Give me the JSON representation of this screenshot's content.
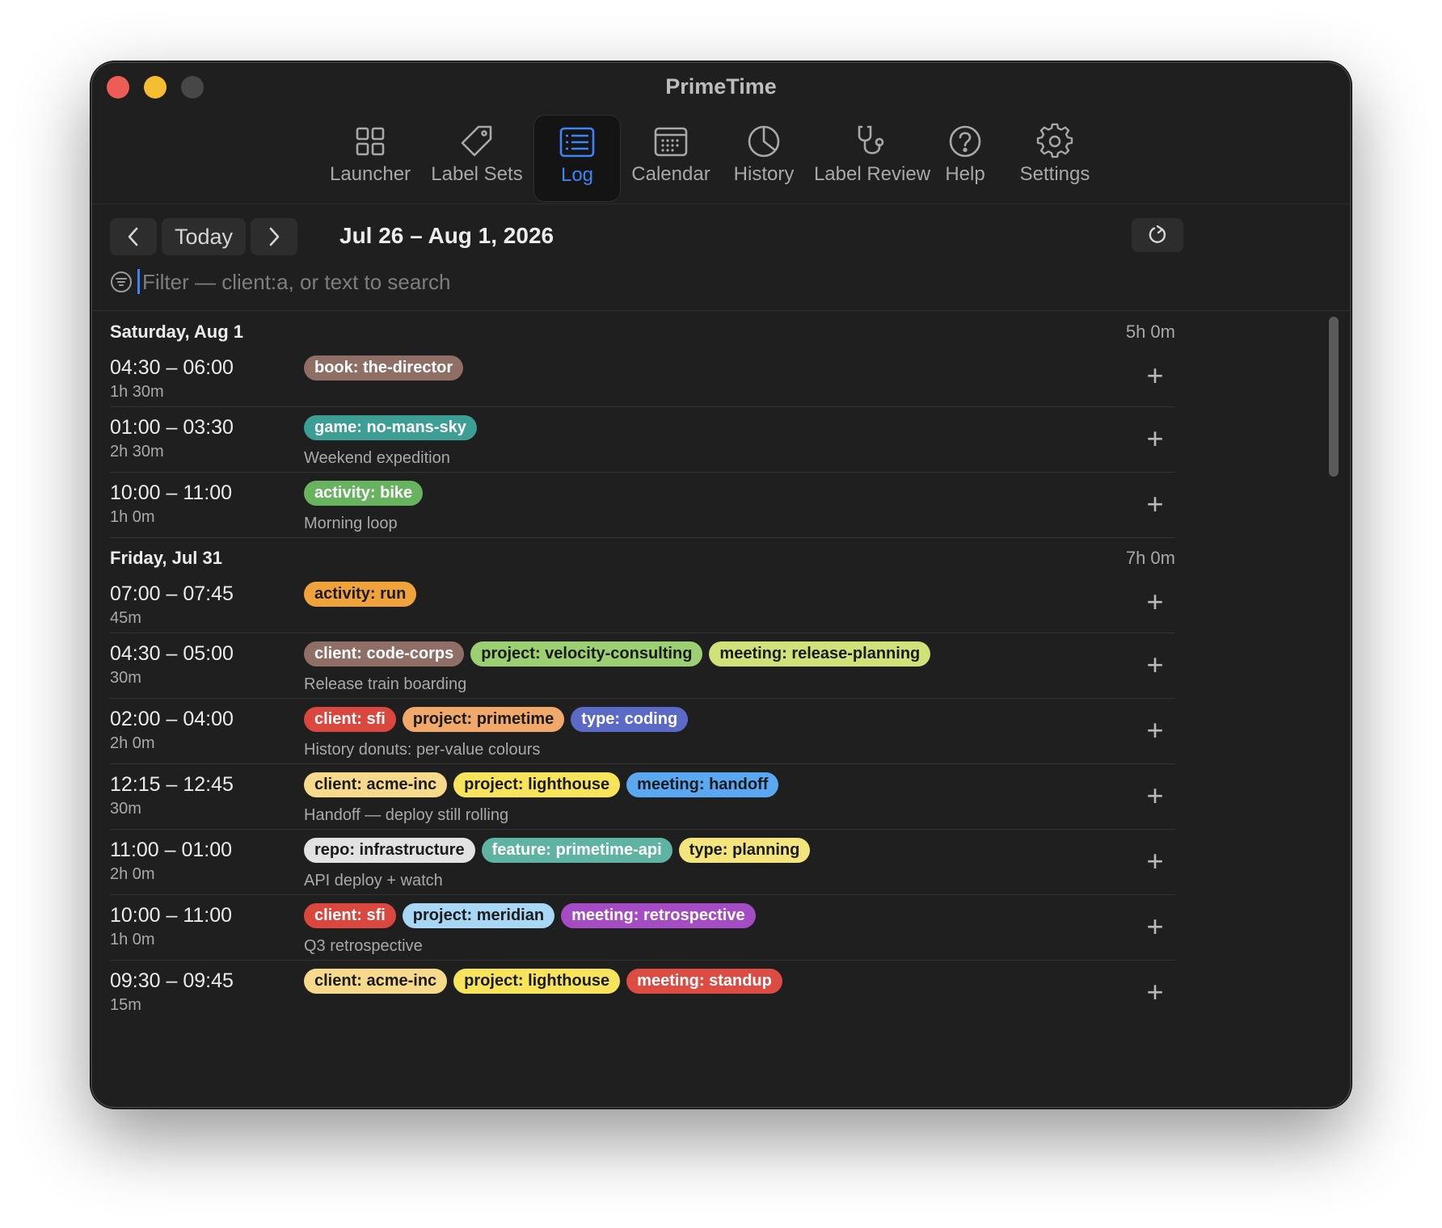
{
  "window": {
    "title": "PrimeTime"
  },
  "toolbar": {
    "launcher": "Launcher",
    "label_sets": "Label Sets",
    "log": "Log",
    "calendar": "Calendar",
    "history": "History",
    "label_review": "Label Review",
    "help": "Help",
    "settings": "Settings",
    "active": "Log"
  },
  "nav": {
    "prev_icon": "chevron-left-icon",
    "today": "Today",
    "next_icon": "chevron-right-icon",
    "range": "Jul 26 – Aug 1, 2026",
    "refresh_icon": "refresh-icon"
  },
  "filter": {
    "placeholder": "Filter — client:a, or text to search",
    "value": ""
  },
  "days": [
    {
      "name": "Saturday, Aug 1",
      "total": "5h 0m",
      "entries": [
        {
          "time": "04:30 – 06:00",
          "duration": "1h 30m",
          "labels": [
            {
              "text": "book: the-director",
              "bg": "#8f6e66",
              "fg": "#ffffff"
            }
          ],
          "note": ""
        },
        {
          "time": "01:00 – 03:30",
          "duration": "2h 30m",
          "labels": [
            {
              "text": "game: no-mans-sky",
              "bg": "#3d9e95",
              "fg": "#ffffff"
            }
          ],
          "note": "Weekend expedition"
        },
        {
          "time": "10:00 – 11:00",
          "duration": "1h 0m",
          "labels": [
            {
              "text": "activity: bike",
              "bg": "#67b35f",
              "fg": "#ffffff"
            }
          ],
          "note": "Morning loop"
        }
      ]
    },
    {
      "name": "Friday, Jul 31",
      "total": "7h 0m",
      "entries": [
        {
          "time": "07:00 – 07:45",
          "duration": "45m",
          "labels": [
            {
              "text": "activity: run",
              "bg": "#f1a33b",
              "fg": "#1a1a1a"
            }
          ],
          "note": ""
        },
        {
          "time": "04:30 – 05:00",
          "duration": "30m",
          "labels": [
            {
              "text": "client: code-corps",
              "bg": "#8f6e66",
              "fg": "#ffffff"
            },
            {
              "text": "project: velocity-consulting",
              "bg": "#9ccf71",
              "fg": "#1a1a1a"
            },
            {
              "text": "meeting: release-planning",
              "bg": "#cfe27a",
              "fg": "#1a1a1a"
            }
          ],
          "note": "Release train boarding"
        },
        {
          "time": "02:00 – 04:00",
          "duration": "2h 0m",
          "labels": [
            {
              "text": "client: sfi",
              "bg": "#d9473f",
              "fg": "#ffffff"
            },
            {
              "text": "project: primetime",
              "bg": "#f1a86b",
              "fg": "#1a1a1a"
            },
            {
              "text": "type: coding",
              "bg": "#5a6ac6",
              "fg": "#ffffff"
            }
          ],
          "note": "History donuts: per-value colours"
        },
        {
          "time": "12:15 – 12:45",
          "duration": "30m",
          "labels": [
            {
              "text": "client: acme-inc",
              "bg": "#f6d98a",
              "fg": "#1a1a1a"
            },
            {
              "text": "project: lighthouse",
              "bg": "#f8e45a",
              "fg": "#1a1a1a"
            },
            {
              "text": "meeting: handoff",
              "bg": "#5aa8f2",
              "fg": "#1a1a1a"
            }
          ],
          "note": "Handoff — deploy still rolling"
        },
        {
          "time": "11:00 – 01:00",
          "duration": "2h 0m",
          "labels": [
            {
              "text": "repo: infrastructure",
              "bg": "#e2e2e2",
              "fg": "#1a1a1a"
            },
            {
              "text": "feature: primetime-api",
              "bg": "#5fb3a3",
              "fg": "#ffffff"
            },
            {
              "text": "type: planning",
              "bg": "#f3e57c",
              "fg": "#1a1a1a"
            }
          ],
          "note": "API deploy + watch"
        },
        {
          "time": "10:00 – 11:00",
          "duration": "1h 0m",
          "labels": [
            {
              "text": "client: sfi",
              "bg": "#d9473f",
              "fg": "#ffffff"
            },
            {
              "text": "project: meridian",
              "bg": "#a8d7f5",
              "fg": "#1a1a1a"
            },
            {
              "text": "meeting: retrospective",
              "bg": "#a54bc4",
              "fg": "#ffffff"
            }
          ],
          "note": "Q3 retrospective"
        },
        {
          "time": "09:30 – 09:45",
          "duration": "15m",
          "labels": [
            {
              "text": "client: acme-inc",
              "bg": "#f6d98a",
              "fg": "#1a1a1a"
            },
            {
              "text": "project: lighthouse",
              "bg": "#f8e45a",
              "fg": "#1a1a1a"
            },
            {
              "text": "meeting: standup",
              "bg": "#dc4c42",
              "fg": "#ffffff"
            }
          ],
          "note": ""
        }
      ]
    }
  ],
  "colors": {
    "accent": "#3d84f6",
    "background": "#1f1f1f"
  },
  "scroll": {
    "position": 0.0,
    "visible_fraction": 0.2
  }
}
